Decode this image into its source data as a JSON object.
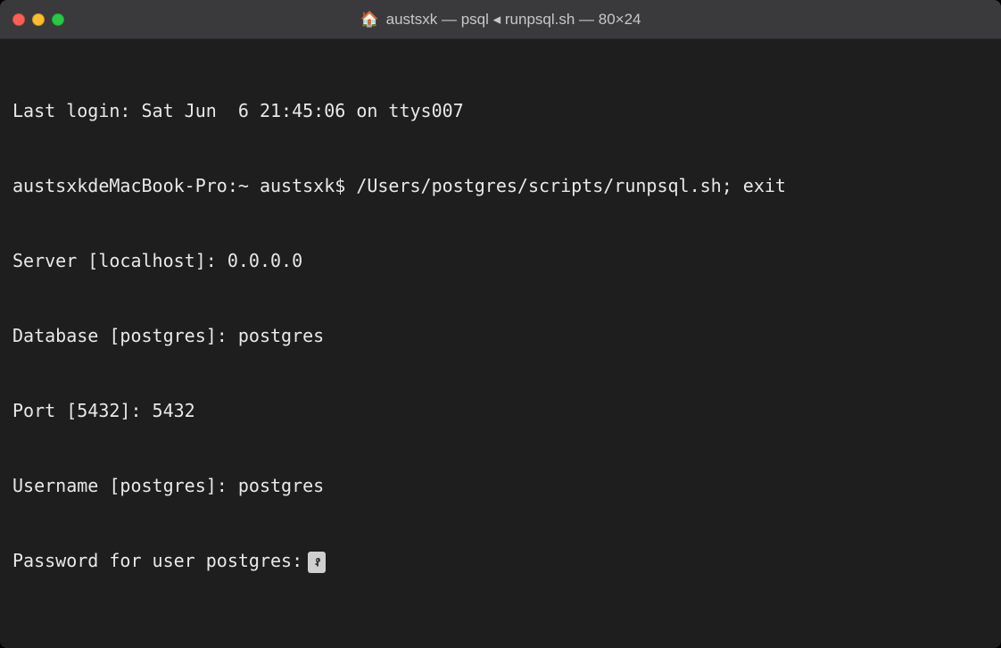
{
  "titlebar": {
    "title": "austsxk — psql ◂ runpsql.sh — 80×24",
    "icon": "home-icon"
  },
  "terminal": {
    "lines": [
      "Last login: Sat Jun  6 21:45:06 on ttys007",
      "austsxkdeMacBook-Pro:~ austsxk$ /Users/postgres/scripts/runpsql.sh; exit",
      "Server [localhost]: 0.0.0.0",
      "Database [postgres]: postgres",
      "Port [5432]: 5432",
      "Username [postgres]: postgres"
    ],
    "password_prompt": "Password for user postgres:"
  }
}
